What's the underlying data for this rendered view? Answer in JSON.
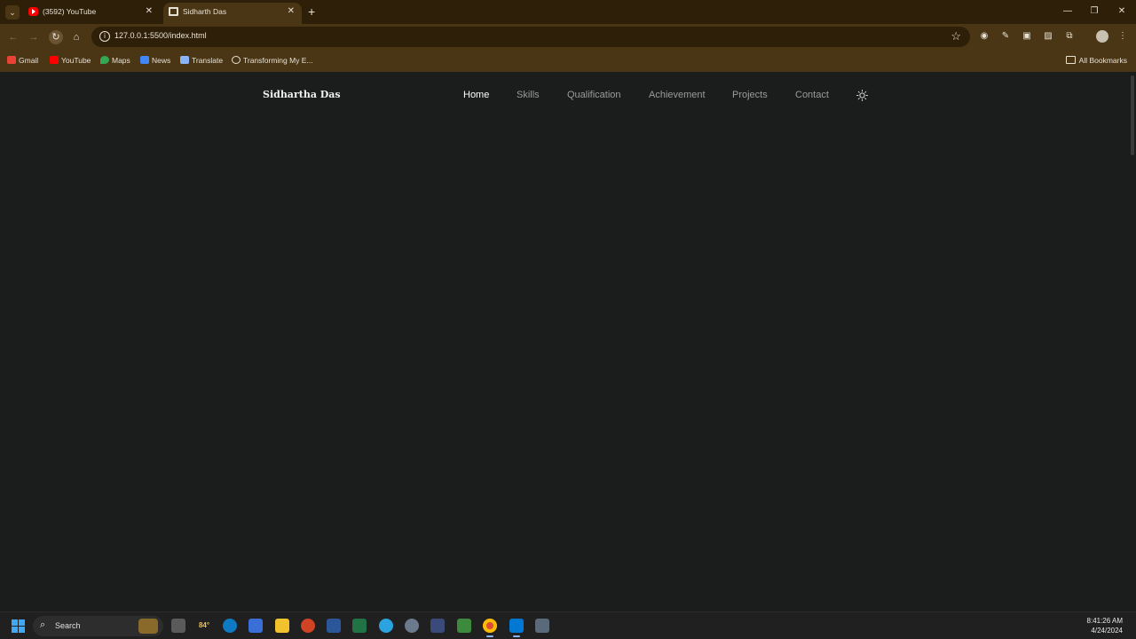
{
  "browser": {
    "tabs": [
      {
        "title": "(3592) YouTube",
        "icon": "youtube-icon",
        "active": false
      },
      {
        "title": "Sidharth Das",
        "icon": "site-icon",
        "active": true
      }
    ],
    "url": "127.0.0.1:5500/index.html",
    "bookmarks": [
      {
        "label": "Gmail",
        "icon": "gmail-icon"
      },
      {
        "label": "YouTube",
        "icon": "youtube-icon"
      },
      {
        "label": "Maps",
        "icon": "maps-icon"
      },
      {
        "label": "News",
        "icon": "news-icon"
      },
      {
        "label": "Translate",
        "icon": "translate-icon"
      },
      {
        "label": "Transforming My E...",
        "icon": "globe-icon"
      }
    ],
    "all_bookmarks": "All Bookmarks"
  },
  "site": {
    "logo": "Sidhartha Das",
    "nav": [
      "Home",
      "Skills",
      "Qualification",
      "Achievement",
      "Projects",
      "Contact"
    ],
    "active_nav": "Home",
    "theme_toggle_icon": "sun-icon"
  },
  "taskbar": {
    "search_placeholder": "Search",
    "weather": "84°",
    "time": "8:41:26 AM",
    "date": "4/24/2024"
  },
  "colors": {
    "tab_strip": "#2e1f08",
    "toolbar": "#4a3514",
    "page_bg": "#1b1c1c",
    "nav_text": "#9a9c9c",
    "nav_active": "#ffffff"
  }
}
